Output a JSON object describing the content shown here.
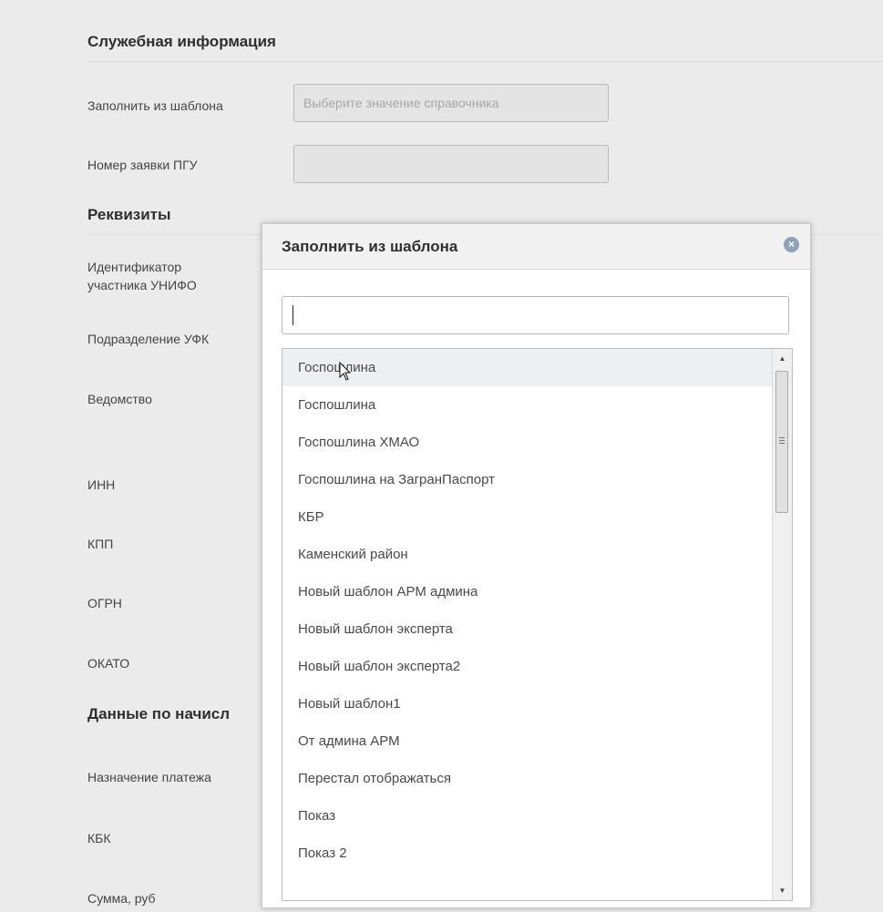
{
  "sections": {
    "service_info": "Служебная информация",
    "requisites": "Реквизиты",
    "accrual_data": "Данные по начисл"
  },
  "fields": {
    "fill_template_label": "Заполнить из шаблона",
    "fill_template_placeholder": "Выберите значение справочника",
    "pgu_request_label": "Номер заявки ПГУ",
    "unifo_id_label_1": "Идентификатор",
    "unifo_id_label_2": "участника УНИФО",
    "ufk_division_label": "Подразделение УФК",
    "department_label": "Ведомство",
    "inn_label": "ИНН",
    "kpp_label": "КПП",
    "ogrn_label": "ОГРН",
    "okato_label": "ОКАТО",
    "payment_purpose_label": "Назначение платежа",
    "kbk_label": "КБК",
    "amount_label": "Сумма, руб"
  },
  "modal": {
    "title": "Заполнить из шаблона",
    "close_icon": "close-circle-icon",
    "search_value": "",
    "items": [
      "Госпошлина",
      "Госпошлина",
      "Госпошлина ХМАО",
      "Госпошлина на ЗагранПаспорт",
      "КБР",
      "Каменский район",
      "Новый шаблон АРМ админа",
      "Новый шаблон эксперта",
      "Новый шаблон эксперта2",
      "Новый шаблон1",
      "От админа АРМ",
      "Перестал отображаться",
      "Показ",
      "Показ 2"
    ]
  }
}
